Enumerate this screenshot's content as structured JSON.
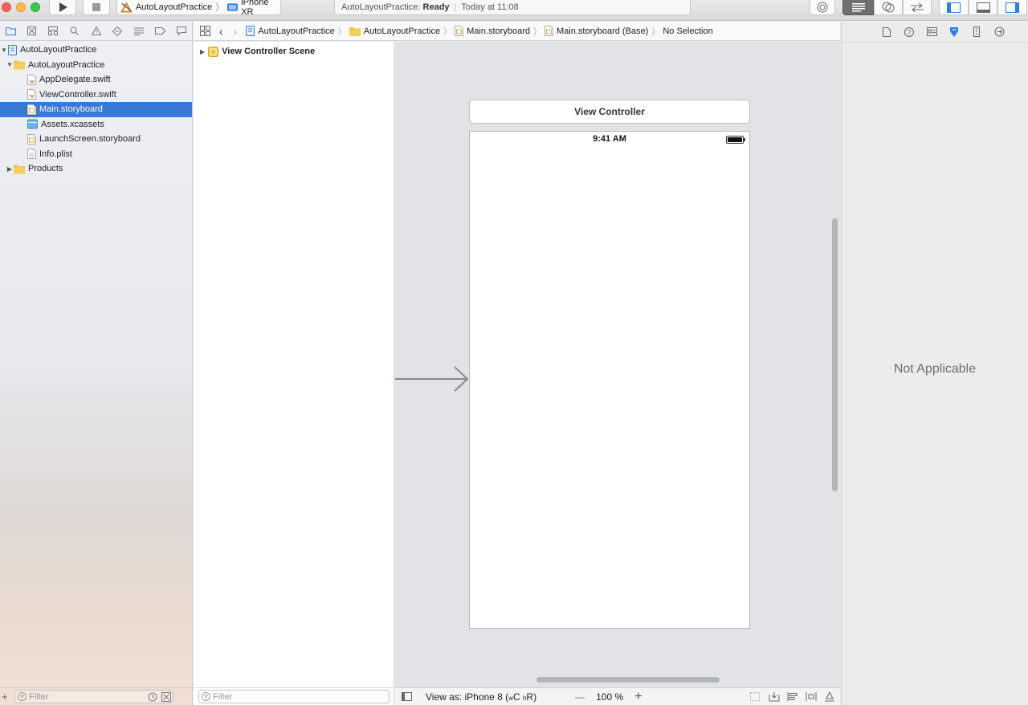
{
  "toolbar": {
    "scheme_target": "AutoLayoutPractice",
    "device": "iPhone XR",
    "activity_project": "AutoLayoutPractice:",
    "activity_status": "Ready",
    "activity_time": "Today at 11:08",
    "icons": [
      "run-icon",
      "stop-icon",
      "breakpoint-icon",
      "standard-editor-icon",
      "assistant-editor-icon",
      "version-editor-icon",
      "navigator-toggle-icon",
      "debug-toggle-icon",
      "utilities-toggle-icon"
    ]
  },
  "navigator": {
    "tab_icons": [
      "folder-icon",
      "source-control-icon",
      "symbol-icon",
      "find-icon",
      "issue-icon",
      "test-icon",
      "debug-icon",
      "breakpoint-icon",
      "report-icon"
    ],
    "items": [
      {
        "label": "AutoLayoutPractice",
        "level": 0,
        "icon": "project",
        "disclosure": "open"
      },
      {
        "label": "AutoLayoutPractice",
        "level": 1,
        "icon": "folder",
        "disclosure": "open"
      },
      {
        "label": "AppDelegate.swift",
        "level": 2,
        "icon": "swift"
      },
      {
        "label": "ViewController.swift",
        "level": 2,
        "icon": "swift"
      },
      {
        "label": "Main.storyboard",
        "level": 2,
        "icon": "storyboard",
        "selected": true
      },
      {
        "label": "Assets.xcassets",
        "level": 2,
        "icon": "assets"
      },
      {
        "label": "LaunchScreen.storyboard",
        "level": 2,
        "icon": "storyboard"
      },
      {
        "label": "Info.plist",
        "level": 2,
        "icon": "plist"
      },
      {
        "label": "Products",
        "level": 0,
        "icon": "folder",
        "disclosure": "closed"
      }
    ],
    "filter_placeholder": "Filter"
  },
  "jumpbar": {
    "crumbs": [
      "AutoLayoutPractice",
      "AutoLayoutPractice",
      "Main.storyboard",
      "Main.storyboard (Base)",
      "No Selection"
    ]
  },
  "outline": {
    "scene_label": "View Controller Scene",
    "filter_placeholder": "Filter"
  },
  "canvas": {
    "vc_title": "View Controller",
    "status_time": "9:41 AM"
  },
  "bottombar": {
    "view_as_prefix": "View as: iPhone 8 (",
    "size_class_w": "w",
    "size_class_C": "C",
    "size_class_h": "h",
    "size_class_R": "R",
    "view_as_suffix": ")",
    "zoom_out": "—",
    "zoom": "100 %",
    "zoom_in": "+"
  },
  "inspector": {
    "tab_icons": [
      "file-inspector-icon",
      "quick-help-icon",
      "identity-inspector-icon",
      "attributes-inspector-icon",
      "size-inspector-icon",
      "connections-inspector-icon"
    ],
    "message": "Not Applicable"
  },
  "colors": {
    "selection": "#3a78d6",
    "accent_blue": "#2f7ce8",
    "folder_yellow": "#f0c440",
    "canvas_bg": "#e2e3e6"
  }
}
